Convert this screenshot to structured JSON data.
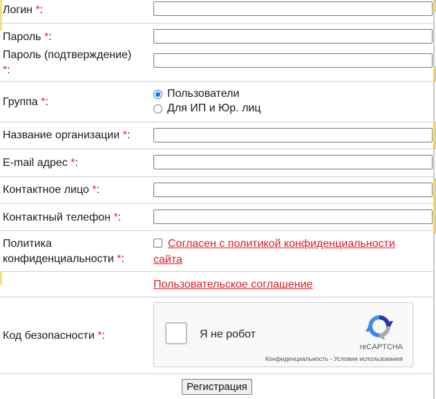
{
  "form": {
    "required_mark": "*",
    "login_label": "Логин",
    "password_label": "Пароль",
    "password_confirm_label": "Пароль (подтверждение)",
    "group_label": "Группа",
    "group_options": [
      "Пользователи",
      "Для ИП и Юр. лиц"
    ],
    "group_selected": "Пользователи",
    "org_label": "Название организации",
    "email_label": "E-mail адрес",
    "contact_label": "Контактное лицо",
    "phone_label": "Контактный телефон",
    "policy_label_line1": "Политика",
    "policy_label_line2": "конфиденциальности",
    "policy_link_line1": "Согласен с политикой конфиденциальности",
    "policy_link_line2": "сайта",
    "policy_checked": false,
    "agreement_link": "Пользовательское соглашение",
    "captcha_label": "Код безопасности",
    "submit_label": "Регистрация"
  },
  "captcha": {
    "checkbox_text": "Я не робот",
    "brand": "reCAPTCHA",
    "links": "Конфиденциальность - Условия использования"
  },
  "colors": {
    "required": "#e3262e",
    "link": "#e01b24",
    "radio_accent": "#1a73e8"
  }
}
